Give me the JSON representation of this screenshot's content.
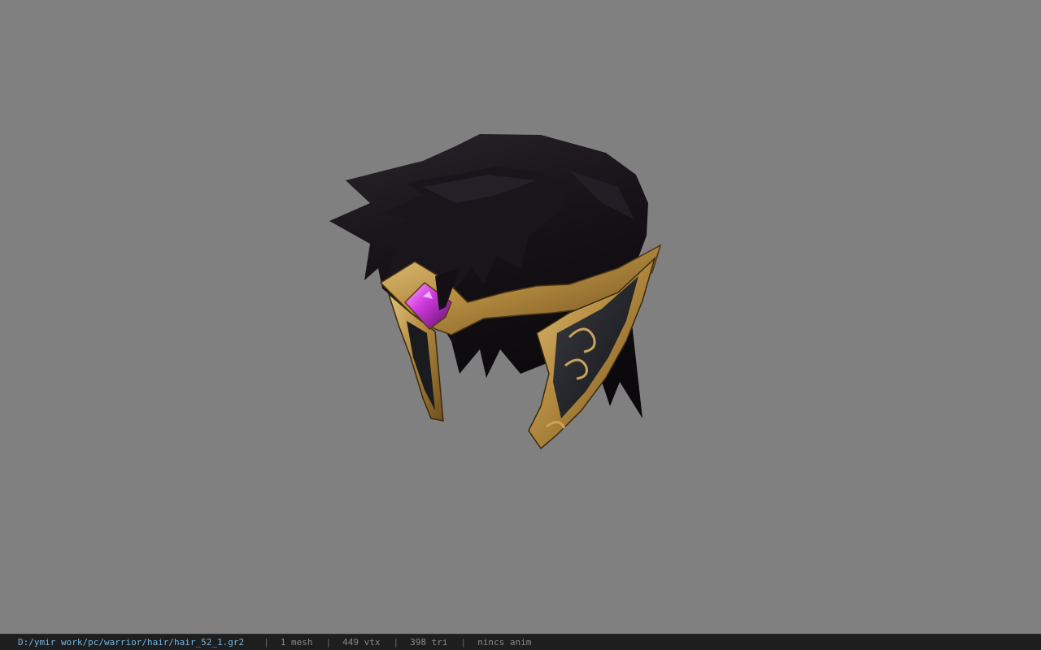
{
  "viewport": {
    "background": "#808080",
    "model_name": "warrior-hair-with-golden-circlet"
  },
  "statusbar": {
    "file_path": "D:/ymir work/pc/warrior/hair/hair_52_1.gr2",
    "separator": "|",
    "mesh_count": "1 mesh",
    "vertex_count": "449 vtx",
    "triangle_count": "398 tri",
    "anim_status": "nincs anim",
    "path_color": "#6fb6e6",
    "text_color": "#8a8a8a"
  }
}
